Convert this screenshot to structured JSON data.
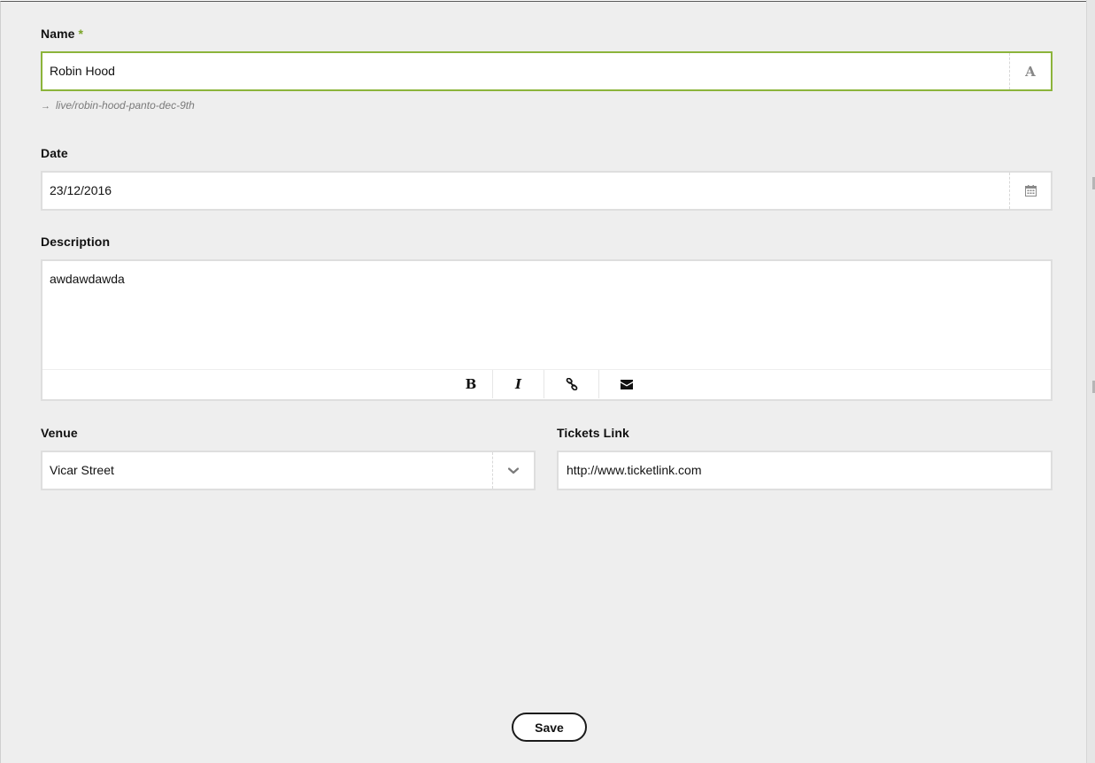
{
  "form": {
    "name": {
      "label": "Name",
      "required_mark": "*",
      "value": "Robin Hood",
      "addon_icon": "text-format-icon",
      "addon_glyph": "A",
      "slug": "live/robin-hood-panto-dec-9th",
      "slug_arrow": "→"
    },
    "date": {
      "label": "Date",
      "value": "23/12/2016",
      "addon_icon": "calendar-icon"
    },
    "description": {
      "label": "Description",
      "value": "awdawdawda",
      "toolbar": {
        "bold_glyph": "B",
        "italic_glyph": "I",
        "link_icon": "link-icon",
        "email_icon": "envelope-icon"
      }
    },
    "venue": {
      "label": "Venue",
      "value": "Vicar Street",
      "addon_icon": "chevron-down-icon"
    },
    "tickets_link": {
      "label": "Tickets Link",
      "value": "http://www.ticketlink.com"
    },
    "save_label": "Save"
  },
  "colors": {
    "accent": "#8cb43b",
    "required": "#7ba428",
    "background": "#eeeeee",
    "field_border": "#dedede"
  }
}
